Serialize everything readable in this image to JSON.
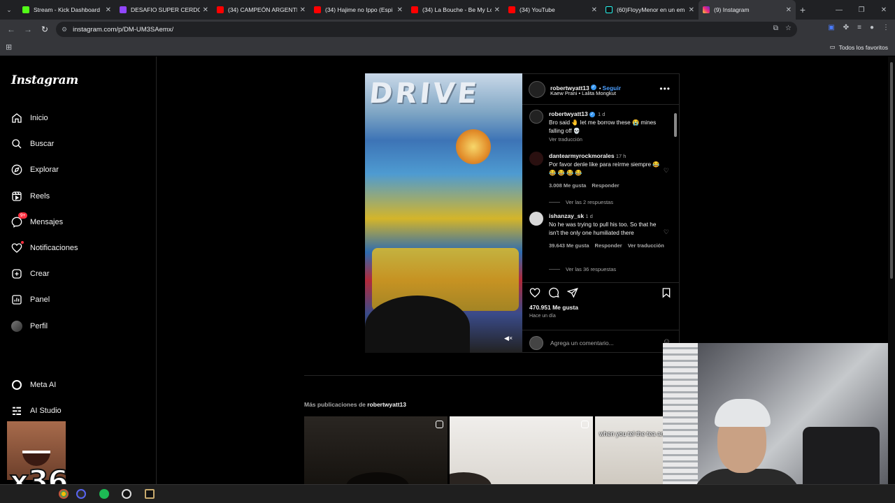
{
  "browser": {
    "tabs": [
      {
        "title": "Stream - Kick Dashboard",
        "favicon_color": "#53fc18",
        "active": false
      },
      {
        "title": "DESAFIO SUPER CERDO C",
        "favicon_color": "#9146ff",
        "active": false
      },
      {
        "title": "(34) CAMPEÓN ARGENTIN",
        "favicon_color": "#ff0000",
        "active": false
      },
      {
        "title": "(34) Hajime no Ippo (Espi",
        "favicon_color": "#ff0000",
        "active": false
      },
      {
        "title": "(34) La Bouche - Be My Lo",
        "favicon_color": "#ff0000",
        "active": false
      },
      {
        "title": "(34) YouTube",
        "favicon_color": "#ff0000",
        "active": false
      },
      {
        "title": "(60)FloyyMenor en un em",
        "favicon_color": "#111111",
        "active": false
      },
      {
        "title": "(9) Instagram",
        "favicon_color": "#e1306c",
        "active": true
      }
    ],
    "url": "instagram.com/p/DM-UM3SAemx/",
    "bookmarks_all": "Todos los favoritos"
  },
  "sidebar": {
    "logo": "Instagram",
    "items": [
      {
        "label": "Inicio",
        "icon": "home-icon"
      },
      {
        "label": "Buscar",
        "icon": "search-icon"
      },
      {
        "label": "Explorar",
        "icon": "compass-icon"
      },
      {
        "label": "Reels",
        "icon": "reels-icon"
      },
      {
        "label": "Mensajes",
        "icon": "messenger-icon",
        "badge": "9+"
      },
      {
        "label": "Notificaciones",
        "icon": "heart-icon"
      },
      {
        "label": "Crear",
        "icon": "plus-square-icon"
      },
      {
        "label": "Panel",
        "icon": "panel-icon"
      },
      {
        "label": "Perfil",
        "icon": "profile-avatar"
      }
    ],
    "bottom_items": [
      {
        "label": "Meta AI",
        "icon": "meta-ai-icon"
      },
      {
        "label": "AI Studio",
        "icon": "ai-studio-icon"
      }
    ]
  },
  "post": {
    "media_sign": "DRIVE",
    "author": "robertwyatt13",
    "follow": "Seguir",
    "audio_artist": "Kaew Prani",
    "audio_song": "Lalita Mongkut",
    "caption": {
      "user": "robertwyatt13",
      "time": "1 d",
      "text": "Bro said 🤚 let me borrow these 😭 mines falling off 💀",
      "translate": "Ver traducción"
    },
    "comments": [
      {
        "user": "dantearmyrockmorales",
        "time": "17 h",
        "text": "Por favor denle like para reírme siempre 😂 😂 😂 😂 😂",
        "likes": "3.008 Me gusta",
        "reply": "Responder",
        "translate": "",
        "replies": "Ver las 2 respuestas"
      },
      {
        "user": "ishanzay_sk",
        "time": "1 d",
        "text": "No he was trying to pull his too. So that he isn't the only one humiliated there",
        "likes": "39.643 Me gusta",
        "reply": "Responder",
        "translate": "Ver traducción",
        "replies": "Ver las 36 respuestas"
      }
    ],
    "like_count": "470.951 Me gusta",
    "posted": "Hace un día",
    "comment_placeholder": "Agrega un comentario..."
  },
  "more_posts": {
    "prefix": "Más publicaciones de",
    "user": "robertwyatt13",
    "thumb_caption": "when you tel the tea and th"
  },
  "overlay": {
    "meme_text": "x36"
  },
  "colors": {
    "accent_blue": "#4a9eff",
    "notification_red": "#ff3040",
    "background": "#000000"
  }
}
